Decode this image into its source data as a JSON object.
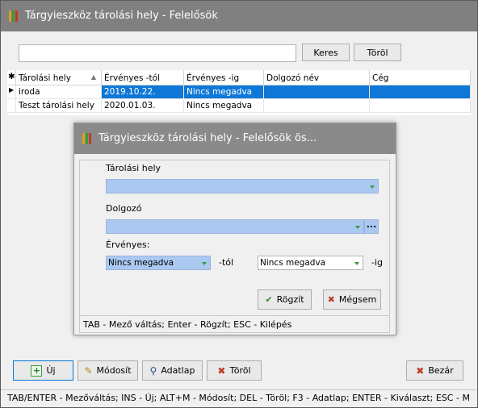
{
  "window": {
    "title": "Tárgyieszköz tárolási hely - Felelősök"
  },
  "search": {
    "value": "",
    "search_label": "Keres",
    "clear_label": "Töröl"
  },
  "table": {
    "columns": [
      "Tárolási hely",
      "Érvényes -tól",
      "Érvényes -ig",
      "Dolgozó név",
      "Cég"
    ],
    "rows": [
      [
        "iroda",
        "2019.10.22.",
        "Nincs megadva",
        "",
        ""
      ],
      [
        "Teszt tárolási hely",
        "2020.01.03.",
        "Nincs megadva",
        "",
        ""
      ]
    ]
  },
  "dialog": {
    "title": "Tárgyieszköz tárolási hely - Felelősök ös...",
    "storage_label": "Tárolási hely",
    "storage_value": "",
    "employee_label": "Dolgozó",
    "employee_value": "",
    "employee_more": "...",
    "valid_label": "Érvényes:",
    "from_value": "Nincs megadva",
    "from_suffix": "-tól",
    "to_value": "Nincs megadva",
    "to_suffix": "-ig",
    "save_label": "Rögzít",
    "cancel_label": "Mégsem",
    "status": "TAB - Mező váltás; Enter - Rögzít; ESC - Kilépés"
  },
  "toolbar": {
    "new_label": "Új",
    "edit_label": "Módosít",
    "details_label": "Adatlap",
    "delete_label": "Töröl",
    "close_label": "Bezár"
  },
  "statusbar": {
    "text": "TAB/ENTER - Mezőváltás; INS - Új; ALT+M - Módosít; DEL - Töröl; F3 - Adatlap; ENTER - Kiválaszt; ESC - M"
  },
  "colors": {
    "selection": "#0f78d7",
    "field_bg": "#aac8f0",
    "titlebar": "#808080"
  }
}
